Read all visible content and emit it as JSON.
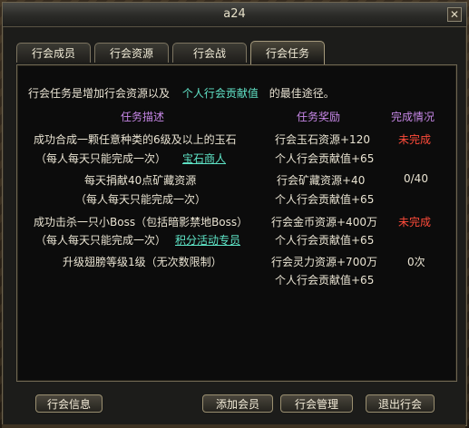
{
  "window": {
    "title": "a24",
    "close_glyph": "✕"
  },
  "tabs": [
    {
      "label": "行会成员",
      "active": false
    },
    {
      "label": "行会资源",
      "active": false
    },
    {
      "label": "行会战",
      "active": false
    },
    {
      "label": "行会任务",
      "active": true
    }
  ],
  "intro": {
    "before": "行会任务是增加行会资源以及",
    "highlight": "个人行会贡献值",
    "after": "的最佳途径。"
  },
  "headers": {
    "desc": "任务描述",
    "reward": "任务奖励",
    "status": "完成情况"
  },
  "tasks": [
    {
      "desc1": "成功合成一颗任意种类的6级及以上的玉石",
      "desc2": "（每人每天只能完成一次）",
      "link": "宝石商人",
      "reward1": "行会玉石资源+120",
      "reward2": "个人行会贡献值+65",
      "status": "未完成"
    },
    {
      "desc1": "每天捐献40点矿藏资源",
      "desc2": "（每人每天只能完成一次）",
      "link": "",
      "reward1": "行会矿藏资源+40",
      "reward2": "个人行会贡献值+65",
      "status": "0/40"
    },
    {
      "desc1": "成功击杀一只小Boss（包括暗影禁地Boss）",
      "desc2": "（每人每天只能完成一次）",
      "link": "积分活动专员",
      "reward1": "行会金币资源+400万",
      "reward2": "个人行会贡献值+65",
      "status": "未完成"
    },
    {
      "desc1": "升级翅膀等级1级（无次数限制）",
      "desc2": "",
      "link": "",
      "reward1": "行会灵力资源+700万",
      "reward2": "个人行会贡献值+65",
      "status": "0次"
    }
  ],
  "buttons": {
    "info": "行会信息",
    "add_member": "添加会员",
    "manage": "行会管理",
    "leave": "退出行会"
  },
  "colors": {
    "accent_cyan": "#61e4c8",
    "header_purple": "#c687e6",
    "incomplete_red": "#ff4b3a"
  }
}
